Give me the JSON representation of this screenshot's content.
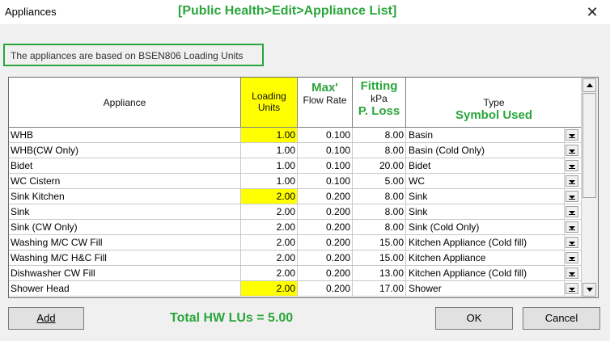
{
  "window": {
    "title": "Appliances",
    "annotation": "[Public Health>Edit>Appliance List]",
    "close_glyph": "✕"
  },
  "info": "The appliances are based on BSEN806 Loading Units",
  "columns": {
    "appliance": "Appliance",
    "loading_1": "Loading",
    "loading_2": "Units",
    "max_green": "Max'",
    "flow": "Flow Rate",
    "fitting_green": "Fitting",
    "kpa": "kPa",
    "ploss_green": "P. Loss",
    "type": "Type",
    "symbol_green": "Symbol Used"
  },
  "rows": [
    {
      "appliance": "WHB",
      "lu": "1.00",
      "flow": "0.100",
      "loss": "8.00",
      "type": "Basin",
      "highlight": true
    },
    {
      "appliance": "WHB(CW Only)",
      "lu": "1.00",
      "flow": "0.100",
      "loss": "8.00",
      "type": "Basin (Cold Only)",
      "highlight": false
    },
    {
      "appliance": "Bidet",
      "lu": "1.00",
      "flow": "0.100",
      "loss": "20.00",
      "type": "Bidet",
      "highlight": false
    },
    {
      "appliance": "WC Cistern",
      "lu": "1.00",
      "flow": "0.100",
      "loss": "5.00",
      "type": "WC",
      "highlight": false
    },
    {
      "appliance": "Sink Kitchen",
      "lu": "2.00",
      "flow": "0.200",
      "loss": "8.00",
      "type": "Sink",
      "highlight": true
    },
    {
      "appliance": "Sink",
      "lu": "2.00",
      "flow": "0.200",
      "loss": "8.00",
      "type": "Sink",
      "highlight": false
    },
    {
      "appliance": "Sink (CW Only)",
      "lu": "2.00",
      "flow": "0.200",
      "loss": "8.00",
      "type": "Sink (Cold Only)",
      "highlight": false
    },
    {
      "appliance": "Washing M/C CW Fill",
      "lu": "2.00",
      "flow": "0.200",
      "loss": "15.00",
      "type": "Kitchen Appliance (Cold fill)",
      "highlight": false
    },
    {
      "appliance": "Washing M/C H&C Fill",
      "lu": "2.00",
      "flow": "0.200",
      "loss": "15.00",
      "type": "Kitchen Appliance",
      "highlight": false
    },
    {
      "appliance": "Dishwasher CW Fill",
      "lu": "2.00",
      "flow": "0.200",
      "loss": "13.00",
      "type": "Kitchen Appliance (Cold fill)",
      "highlight": false
    },
    {
      "appliance": "Shower Head",
      "lu": "2.00",
      "flow": "0.200",
      "loss": "17.00",
      "type": "Shower",
      "highlight": true
    }
  ],
  "buttons": {
    "add": "Add",
    "ok": "OK",
    "cancel": "Cancel"
  },
  "total": "Total HW LUs = 5.00",
  "colors": {
    "annotation_green": "#2aa63c",
    "highlight_yellow": "#ffff00"
  }
}
